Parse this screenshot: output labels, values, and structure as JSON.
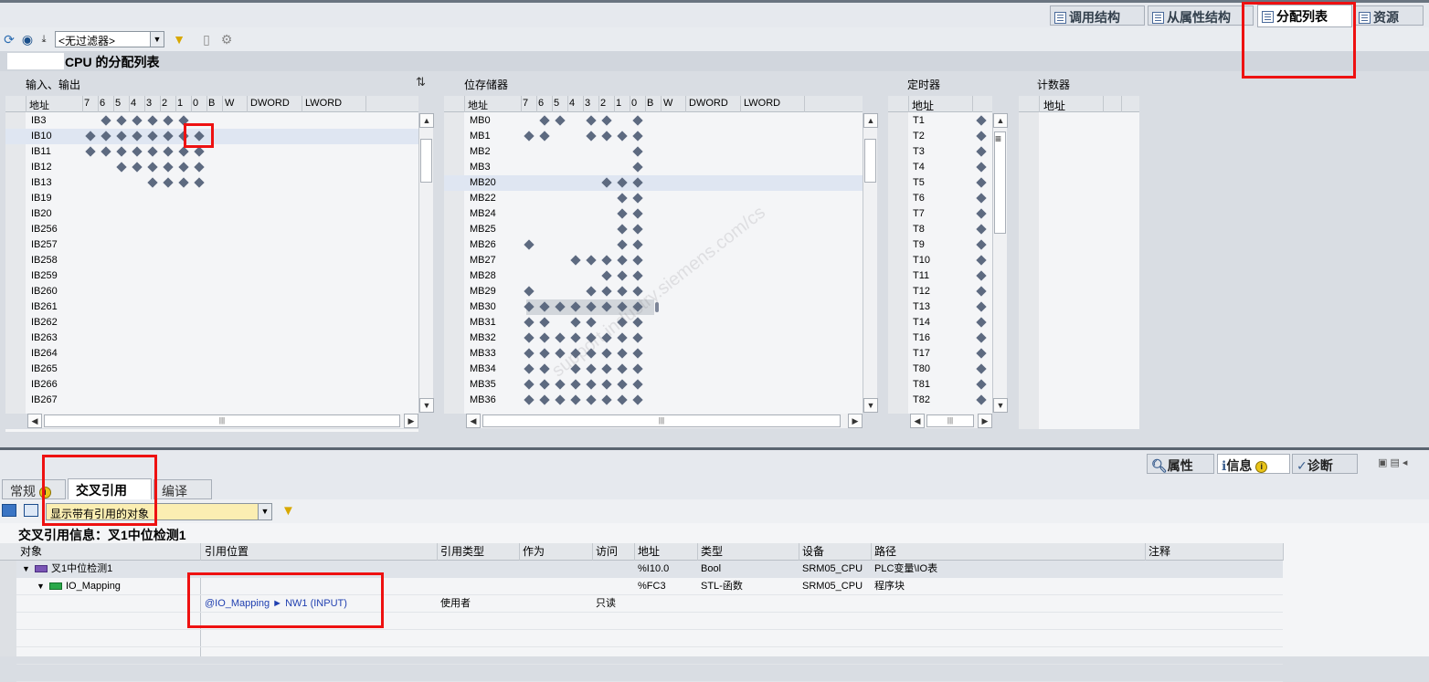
{
  "top_tabs": [
    {
      "label": "调用结构",
      "active": false
    },
    {
      "label": "从属性结构",
      "active": false
    },
    {
      "label": "分配列表",
      "active": true
    },
    {
      "label": "资源",
      "active": false
    }
  ],
  "filter": {
    "value": "<无过滤器>"
  },
  "title": "CPU 的分配列表",
  "io": {
    "section": "输入、输出",
    "headers": [
      "地址",
      "7",
      "6",
      "5",
      "4",
      "3",
      "2",
      "1",
      "0",
      "B",
      "W",
      "DWORD",
      "LWORD"
    ],
    "rows": [
      {
        "addr": "IB3",
        "bits": [
          0,
          1,
          1,
          1,
          1,
          1,
          1,
          0
        ]
      },
      {
        "addr": "IB10",
        "bits": [
          1,
          1,
          1,
          1,
          1,
          1,
          1,
          1
        ]
      },
      {
        "addr": "IB11",
        "bits": [
          1,
          1,
          1,
          1,
          1,
          1,
          1,
          1
        ]
      },
      {
        "addr": "IB12",
        "bits": [
          0,
          0,
          1,
          1,
          1,
          1,
          1,
          1
        ]
      },
      {
        "addr": "IB13",
        "bits": [
          0,
          0,
          0,
          0,
          1,
          1,
          1,
          1
        ]
      },
      {
        "addr": "IB19",
        "bits": [
          0,
          0,
          0,
          0,
          0,
          0,
          0,
          0
        ]
      },
      {
        "addr": "IB20",
        "bits": [
          0,
          0,
          0,
          0,
          0,
          0,
          0,
          0
        ]
      },
      {
        "addr": "IB256",
        "bits": [
          0,
          0,
          0,
          0,
          0,
          0,
          0,
          0
        ]
      },
      {
        "addr": "IB257",
        "bits": [
          0,
          0,
          0,
          0,
          0,
          0,
          0,
          0
        ]
      },
      {
        "addr": "IB258",
        "bits": [
          0,
          0,
          0,
          0,
          0,
          0,
          0,
          0
        ]
      },
      {
        "addr": "IB259",
        "bits": [
          0,
          0,
          0,
          0,
          0,
          0,
          0,
          0
        ]
      },
      {
        "addr": "IB260",
        "bits": [
          0,
          0,
          0,
          0,
          0,
          0,
          0,
          0
        ]
      },
      {
        "addr": "IB261",
        "bits": [
          0,
          0,
          0,
          0,
          0,
          0,
          0,
          0
        ]
      },
      {
        "addr": "IB262",
        "bits": [
          0,
          0,
          0,
          0,
          0,
          0,
          0,
          0
        ]
      },
      {
        "addr": "IB263",
        "bits": [
          0,
          0,
          0,
          0,
          0,
          0,
          0,
          0
        ]
      },
      {
        "addr": "IB264",
        "bits": [
          0,
          0,
          0,
          0,
          0,
          0,
          0,
          0
        ]
      },
      {
        "addr": "IB265",
        "bits": [
          0,
          0,
          0,
          0,
          0,
          0,
          0,
          0
        ]
      },
      {
        "addr": "IB266",
        "bits": [
          0,
          0,
          0,
          0,
          0,
          0,
          0,
          0
        ]
      },
      {
        "addr": "IB267",
        "bits": [
          0,
          0,
          0,
          0,
          0,
          0,
          0,
          0
        ]
      }
    ]
  },
  "memory": {
    "section": "位存储器",
    "headers": [
      "地址",
      "7",
      "6",
      "5",
      "4",
      "3",
      "2",
      "1",
      "0",
      "B",
      "W",
      "DWORD",
      "LWORD"
    ],
    "rows": [
      {
        "addr": "MB0",
        "bits": [
          0,
          1,
          1,
          0,
          1,
          1,
          0,
          1
        ]
      },
      {
        "addr": "MB1",
        "bits": [
          1,
          1,
          0,
          0,
          1,
          1,
          1,
          1
        ]
      },
      {
        "addr": "MB2",
        "bits": [
          0,
          0,
          0,
          0,
          0,
          0,
          0,
          1
        ]
      },
      {
        "addr": "MB3",
        "bits": [
          0,
          0,
          0,
          0,
          0,
          0,
          0,
          1
        ]
      },
      {
        "addr": "MB20",
        "bits": [
          0,
          0,
          0,
          0,
          0,
          1,
          1,
          1
        ]
      },
      {
        "addr": "MB22",
        "bits": [
          0,
          0,
          0,
          0,
          0,
          0,
          1,
          1
        ]
      },
      {
        "addr": "MB24",
        "bits": [
          0,
          0,
          0,
          0,
          0,
          0,
          1,
          1
        ]
      },
      {
        "addr": "MB25",
        "bits": [
          0,
          0,
          0,
          0,
          0,
          0,
          1,
          1
        ]
      },
      {
        "addr": "MB26",
        "bits": [
          1,
          0,
          0,
          0,
          0,
          0,
          1,
          1
        ]
      },
      {
        "addr": "MB27",
        "bits": [
          0,
          0,
          0,
          1,
          1,
          1,
          1,
          1
        ]
      },
      {
        "addr": "MB28",
        "bits": [
          0,
          0,
          0,
          0,
          0,
          1,
          1,
          1
        ]
      },
      {
        "addr": "MB29",
        "bits": [
          1,
          0,
          0,
          0,
          1,
          1,
          1,
          1
        ]
      },
      {
        "addr": "MB30",
        "bits": [
          1,
          1,
          1,
          1,
          1,
          1,
          1,
          1
        ]
      },
      {
        "addr": "MB31",
        "bits": [
          1,
          1,
          0,
          1,
          1,
          0,
          1,
          1
        ]
      },
      {
        "addr": "MB32",
        "bits": [
          1,
          1,
          1,
          1,
          1,
          1,
          1,
          1
        ]
      },
      {
        "addr": "MB33",
        "bits": [
          1,
          1,
          1,
          1,
          1,
          1,
          1,
          1
        ]
      },
      {
        "addr": "MB34",
        "bits": [
          1,
          1,
          0,
          1,
          1,
          1,
          1,
          1
        ]
      },
      {
        "addr": "MB35",
        "bits": [
          1,
          1,
          1,
          1,
          1,
          1,
          1,
          1
        ]
      },
      {
        "addr": "MB36",
        "bits": [
          1,
          1,
          1,
          1,
          1,
          1,
          1,
          1
        ]
      }
    ]
  },
  "timers": {
    "section": "定时器",
    "header": "地址",
    "rows": [
      "T1",
      "T2",
      "T3",
      "T4",
      "T5",
      "T6",
      "T7",
      "T8",
      "T9",
      "T10",
      "T11",
      "T12",
      "T13",
      "T14",
      "T16",
      "T17",
      "T80",
      "T81",
      "T82"
    ]
  },
  "counters": {
    "section": "计数器",
    "header": "地址"
  },
  "inspector_tabs": [
    {
      "label": "属性"
    },
    {
      "label": "信息"
    },
    {
      "label": "诊断"
    }
  ],
  "panel_tabs": [
    {
      "label": "常规"
    },
    {
      "label": "交叉引用",
      "active": true
    },
    {
      "label": "编译"
    }
  ],
  "xref": {
    "filter_value": "显示带有引用的对象",
    "title": "交叉引用信息：叉1中位检测1",
    "columns": [
      "对象",
      "引用位置",
      "引用类型",
      "作为",
      "访问",
      "地址",
      "类型",
      "设备",
      "路径",
      "注释"
    ],
    "rows": [
      {
        "object": "叉1中位检测1",
        "location": "",
        "reftype": "",
        "as": "",
        "access": "",
        "address": "%I10.0",
        "type": "Bool",
        "device": "SRM05_CPU",
        "path": "PLC变量\\IO表"
      },
      {
        "object": "IO_Mapping",
        "location": "",
        "reftype": "",
        "as": "",
        "access": "",
        "address": "%FC3",
        "type": "STL-函数",
        "device": "SRM05_CPU",
        "path": "程序块"
      },
      {
        "object": "",
        "location": "@IO_Mapping ► NW1 (INPUT)",
        "reftype": "使用者",
        "as": "",
        "access": "只读",
        "address": "",
        "type": "",
        "device": "",
        "path": ""
      }
    ]
  },
  "watermark": "support.industry.siemens.com/cs"
}
